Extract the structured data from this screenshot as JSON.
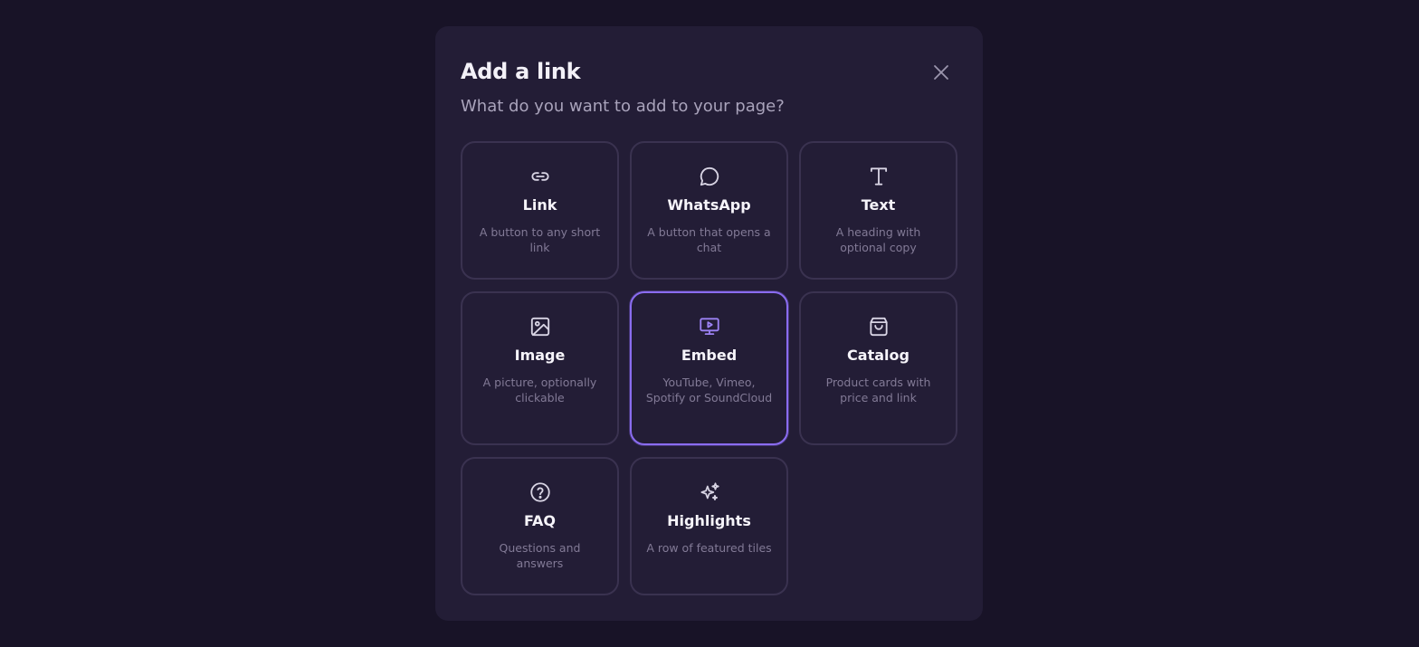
{
  "modal": {
    "title": "Add a link",
    "subtitle": "What do you want to add to your page?",
    "close_icon": "close-icon"
  },
  "colors": {
    "background": "#181327",
    "modal": "#231d36",
    "card_border": "#3a3250",
    "selected_accent": "#8a6cf0"
  },
  "options": [
    {
      "title": "Link",
      "description": "A button to any short link",
      "icon": "link-icon",
      "selected": false
    },
    {
      "title": "WhatsApp",
      "description": "A button that opens a chat",
      "icon": "chat-bubble-icon",
      "selected": false
    },
    {
      "title": "Text",
      "description": "A heading with optional copy",
      "icon": "text-icon",
      "selected": false
    },
    {
      "title": "Image",
      "description": "A picture, optionally clickable",
      "icon": "image-icon",
      "selected": false
    },
    {
      "title": "Embed",
      "description": "YouTube, Vimeo, Spotify or SoundCloud",
      "icon": "video-embed-icon",
      "selected": true
    },
    {
      "title": "Catalog",
      "description": "Product cards with price and link",
      "icon": "shopping-bag-icon",
      "selected": false
    },
    {
      "title": "FAQ",
      "description": "Questions and answers",
      "icon": "question-circle-icon",
      "selected": false
    },
    {
      "title": "Highlights",
      "description": "A row of featured tiles",
      "icon": "sparkles-icon",
      "selected": false
    }
  ]
}
